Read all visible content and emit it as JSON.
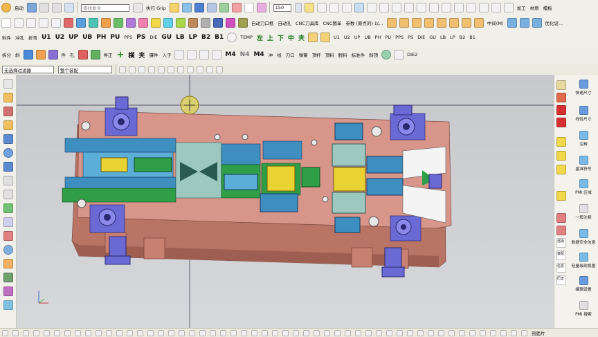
{
  "toolbar1": {
    "start_label": "启动",
    "search_placeholder": "查找命令",
    "snap_label": "执行 Grip",
    "zoom_value": "150",
    "machining_label": "加工",
    "material_label": "材质",
    "template_label": "模板",
    "params_label": "参数 (原点的) 以..."
  },
  "toolbar2": {
    "auto_hole_label": "自动刀口框",
    "auto_cut_label": "自动孔",
    "cnc_knife_label": "CNC刀具库",
    "cnc_cut_label": "CNC图单",
    "center_label": "中间(M)",
    "optimize_label": "优化设..."
  },
  "toolbar3": {
    "module_label": "料件",
    "punch_label": "冲孔",
    "bend_label": "折弯",
    "buttons": [
      "U1",
      "U2",
      "UP",
      "UB",
      "PH",
      "PU",
      "PPS",
      "PS",
      "DIE",
      "GU",
      "LB",
      "LP",
      "B2",
      "B1"
    ],
    "temp_label": "TEMP",
    "nav_arrows": [
      "左",
      "上",
      "下",
      "中",
      "夹"
    ],
    "buttons_right": [
      "U1",
      "U2",
      "UP",
      "UB",
      "PH",
      "PU",
      "PPS",
      "PS",
      "DIE",
      "GU",
      "LB",
      "LP",
      "B2",
      "B1"
    ]
  },
  "toolbar4": {
    "labels": [
      "拆分",
      "斜",
      "件",
      "孔",
      "导正",
      "镶件",
      "入子",
      "冲",
      "线"
    ],
    "symbols": [
      "+",
      "横",
      "夹"
    ],
    "m_buttons": [
      "M4",
      "N4",
      "M4"
    ],
    "misc_labels": [
      "刀口",
      "弹簧",
      "顶杆",
      "顶料",
      "脱料",
      "标准件",
      "斜顶",
      "DIE2"
    ]
  },
  "selection_bar": {
    "filter_value": "无选择过滤器",
    "scope_value": "整个装配"
  },
  "right_panel": {
    "items": [
      {
        "label": "快速尺寸",
        "icon": "quick-dimension-icon"
      },
      {
        "label": "线性尺寸",
        "icon": "linear-dimension-icon"
      },
      {
        "label": "注释",
        "icon": "note-icon"
      },
      {
        "label": "基准符号",
        "icon": "datum-symbol-icon"
      },
      {
        "label": "PMI 区域",
        "icon": "pmi-region-icon"
      },
      {
        "label": "一般注释",
        "icon": "general-note-icon"
      },
      {
        "label": "数据安全信息",
        "icon": "data-security-icon"
      },
      {
        "label": "轻量级剖视图",
        "icon": "lightweight-section-icon"
      },
      {
        "label": "编辑设置",
        "icon": "edit-settings-icon"
      },
      {
        "label": "PMI 搜索",
        "icon": "pmi-search-icon"
      }
    ],
    "side_tabs": [
      "渲染",
      "装配",
      "信息",
      "历史"
    ]
  },
  "statusbar": {
    "right_label": "剖面片"
  },
  "colors": {
    "plate": "#d8958a",
    "plate_dark": "#b87465",
    "insert_blue": "#3f8ec0",
    "insert_green": "#2f9e46",
    "guide_purple": "#6b69d3",
    "yellow": "#e8d332"
  }
}
